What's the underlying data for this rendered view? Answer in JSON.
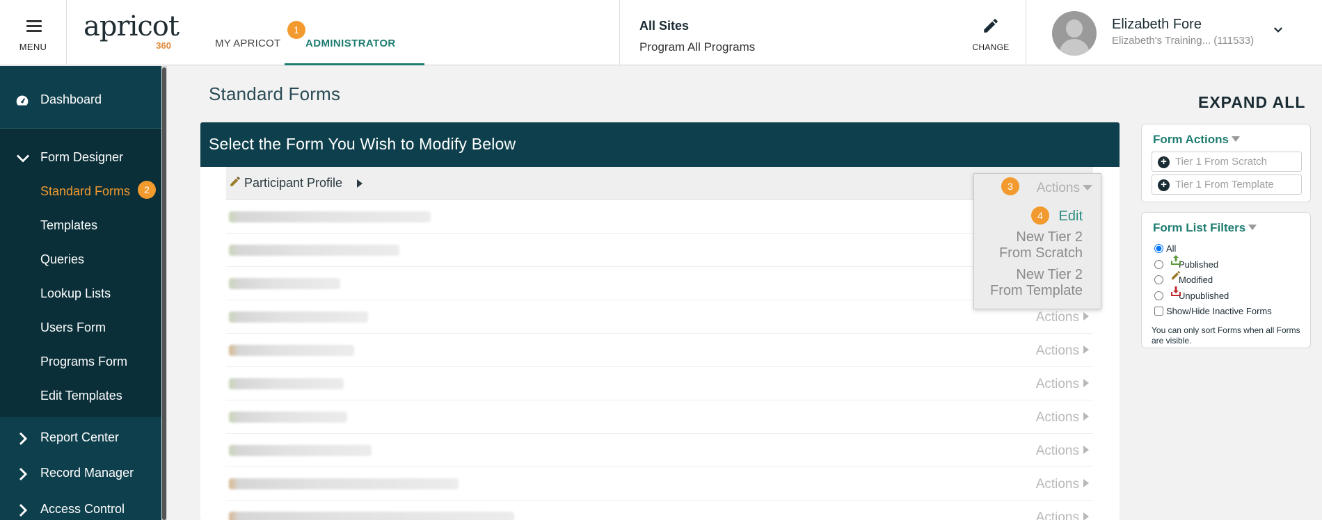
{
  "header": {
    "menu_label": "MENU",
    "logo_word": "apricot",
    "logo_num": "360",
    "tab_my": "MY APRICOT",
    "tab_admin": "ADMINISTRATOR",
    "badge1": "1",
    "site_title": "All Sites",
    "site_program": "Program All Programs",
    "change_label": "CHANGE",
    "user_name": "Elizabeth Fore",
    "user_sub": "Elizabeth's Training...  (111533)",
    "accent": "#1e7c70",
    "badge_color": "#f29a2e"
  },
  "sidebar": {
    "dashboard": "Dashboard",
    "form_designer": "Form Designer",
    "sub_items": [
      "Standard Forms",
      "Templates",
      "Queries",
      "Lookup Lists",
      "Users Form",
      "Programs Form",
      "Edit Templates"
    ],
    "badge2": "2",
    "lower": [
      "Report Center",
      "Record Manager",
      "Access Control"
    ]
  },
  "main": {
    "page_title": "Standard Forms",
    "panel_title": "Select the Form You Wish to Modify Below",
    "first_form": "Participant Profile",
    "actions_label": "Actions",
    "badge3": "3",
    "badge4": "4",
    "dropdown": {
      "edit": "Edit",
      "opt1_line1": "New Tier 2",
      "opt1_line2": "From Scratch",
      "opt2_line1": "New Tier 2",
      "opt2_line2": "From Template"
    }
  },
  "right": {
    "expand_all": "EXPAND ALL",
    "form_actions_title": "Form Actions",
    "btn_scratch": "Tier 1 From Scratch",
    "btn_template": "Tier 1 From Template",
    "filters_title": "Form List Filters",
    "filter_all": "All",
    "filter_published": "Published",
    "filter_modified": "Modified",
    "filter_unpublished": "Unpublished",
    "filter_inactive": "Show/Hide Inactive Forms",
    "note": "You can only sort Forms when all Forms are visible."
  }
}
